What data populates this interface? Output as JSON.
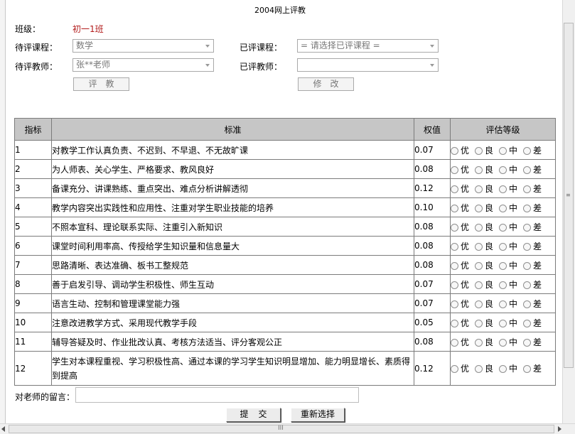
{
  "page": {
    "title": "2004网上评教"
  },
  "form": {
    "class_label": "班级：",
    "class_value": "初一1班",
    "pending_course_label": "待评课程：",
    "pending_course_value": "数学",
    "evaluated_course_label": "已评课程：",
    "evaluated_course_value": "= 请选择已评课程 =",
    "pending_teacher_label": "待评教师：",
    "pending_teacher_value": "张**老师",
    "evaluated_teacher_label": "已评教师：",
    "evaluated_teacher_value": "",
    "evaluate_button": "评教",
    "modify_button": "修改"
  },
  "table": {
    "headers": {
      "index": "指标",
      "criterion": "标准",
      "weight": "权值",
      "grade": "评估等级"
    },
    "grade_options": [
      "优",
      "良",
      "中",
      "差"
    ],
    "rows": [
      {
        "index": "1",
        "criterion": "对教学工作认真负责、不迟到、不早退、不无故旷课",
        "weight": "0.07"
      },
      {
        "index": "2",
        "criterion": "为人师表、关心学生、严格要求、教风良好",
        "weight": "0.08"
      },
      {
        "index": "3",
        "criterion": "备课充分、讲课熟练、重点突出、难点分析讲解透彻",
        "weight": "0.12"
      },
      {
        "index": "4",
        "criterion": "教学内容突出实践性和应用性、注重对学生职业技能的培养",
        "weight": "0.10"
      },
      {
        "index": "5",
        "criterion": "不照本宣科、理论联系实际、注重引入新知识",
        "weight": "0.08"
      },
      {
        "index": "6",
        "criterion": "课堂时间利用率高、传授给学生知识量和信息量大",
        "weight": "0.08"
      },
      {
        "index": "7",
        "criterion": "思路清晰、表达准确、板书工整规范",
        "weight": "0.08"
      },
      {
        "index": "8",
        "criterion": "善于启发引导、调动学生积极性、师生互动",
        "weight": "0.07"
      },
      {
        "index": "9",
        "criterion": "语言生动、控制和管理课堂能力强",
        "weight": "0.07"
      },
      {
        "index": "10",
        "criterion": "注意改进教学方式、采用现代教学手段",
        "weight": "0.05"
      },
      {
        "index": "11",
        "criterion": "辅导答疑及时、作业批改认真、考核方法适当、评分客观公正",
        "weight": "0.08"
      },
      {
        "index": "12",
        "criterion": "学生对本课程重视、学习积极性高、通过本课的学习学生知识明显增加、能力明显增长、素质得到提高",
        "weight": "0.12"
      }
    ]
  },
  "footer": {
    "comment_label": "对老师的留言：",
    "comment_value": "",
    "submit_button": "提交",
    "reset_button": "重新选择"
  }
}
